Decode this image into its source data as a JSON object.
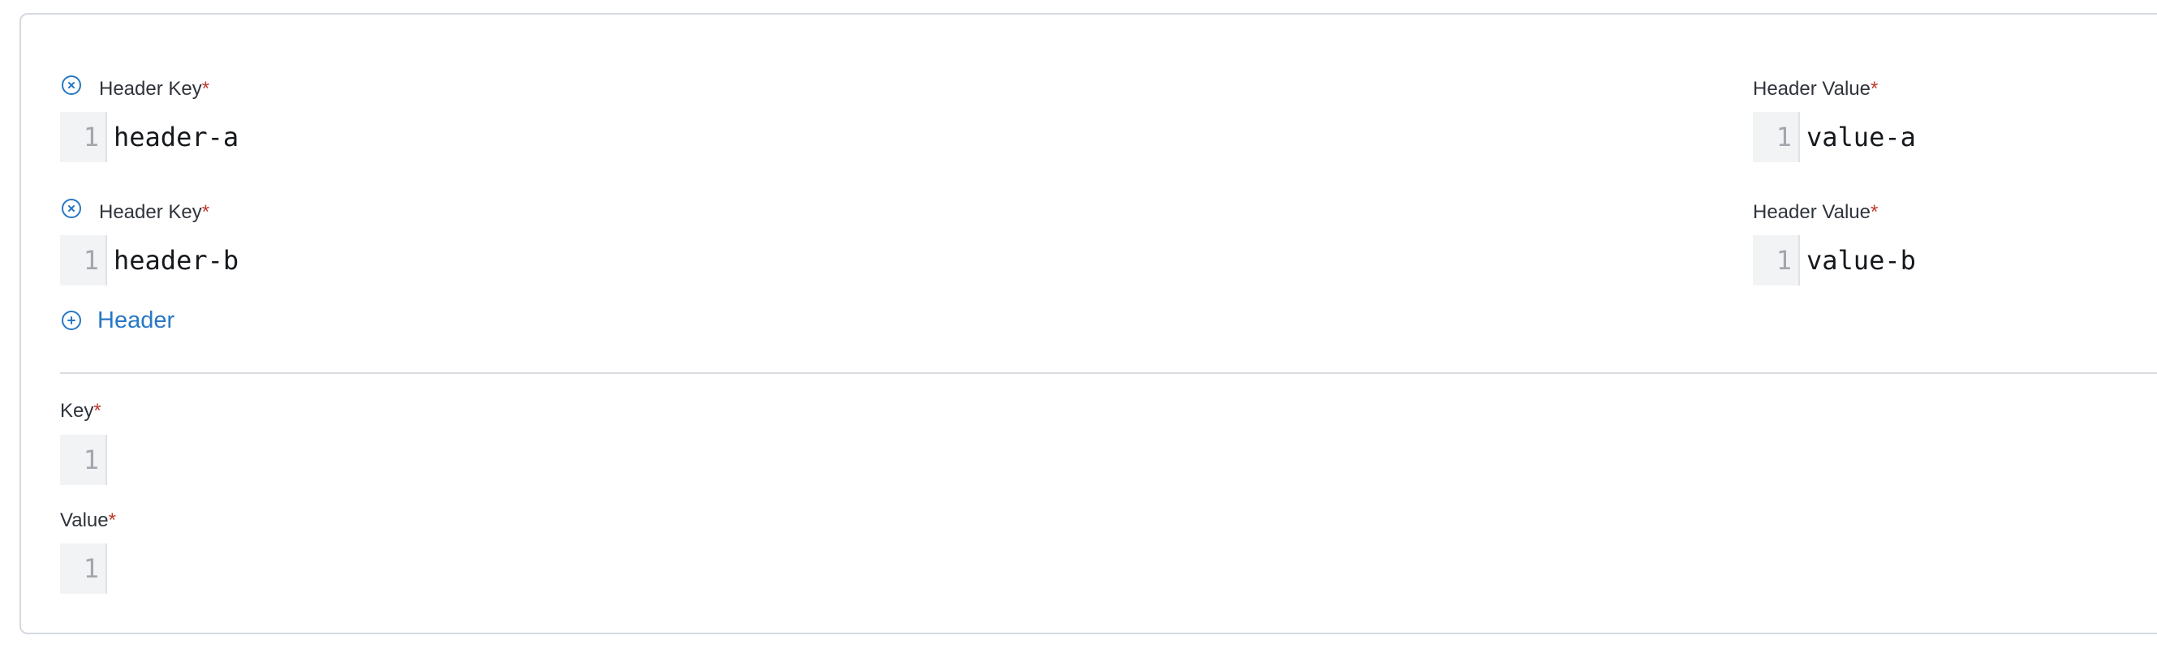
{
  "headers": [
    {
      "key_label": "Header Key",
      "value_label": "Header Value",
      "key_line_number": "1",
      "key": "header-a",
      "value_line_number": "1",
      "value": "value-a"
    },
    {
      "key_label": "Header Key",
      "value_label": "Header Value",
      "key_line_number": "1",
      "key": "header-b",
      "value_line_number": "1",
      "value": "value-b"
    }
  ],
  "required_marker": "*",
  "add_header_label": "Header",
  "message": {
    "key_label": "Key",
    "key_line_number": "1",
    "key": "",
    "value_label": "Value",
    "value_line_number": "1",
    "value": ""
  },
  "colors": {
    "accent": "#2778c4",
    "required": "#c0392b",
    "border": "#d5d9e0",
    "gutter_bg": "#f2f3f5"
  },
  "icons": {
    "remove": "close-circle-icon",
    "add": "plus-circle-icon"
  }
}
